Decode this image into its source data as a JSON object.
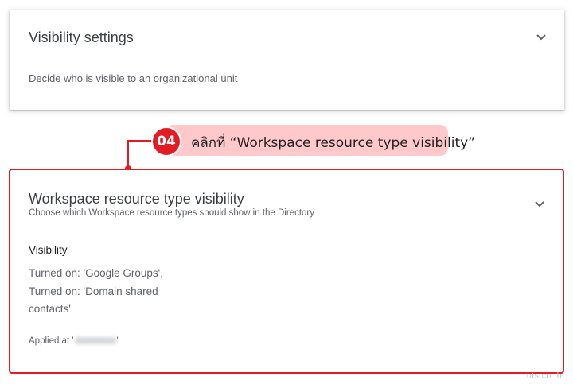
{
  "visibility_card": {
    "title": "Visibility settings",
    "description": "Decide who is visible to an organizational unit"
  },
  "callout": {
    "step": "04",
    "text": "คลิกที่ “Workspace resource type visibility”",
    "color": "#e31b23"
  },
  "resource_card": {
    "title": "Workspace resource type visibility",
    "subtitle": "Choose which Workspace resource types should show in the Directory",
    "visibility_label": "Visibility",
    "line1": "Turned on: 'Google Groups',",
    "line2": "Turned on: 'Domain shared",
    "line3": "contacts'",
    "applied_prefix": "Applied at '",
    "applied_suffix": "'"
  },
  "watermark": "nts.co.th"
}
